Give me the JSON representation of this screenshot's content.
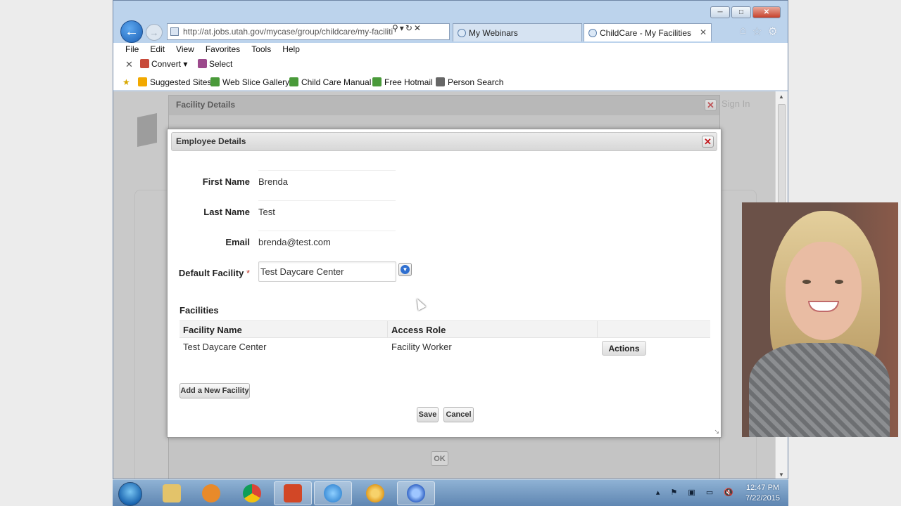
{
  "browser": {
    "address": "http://at.jobs.utah.gov/mycase/group/childcare/my-faciliti",
    "tabs": [
      {
        "label": "My Webinars"
      },
      {
        "label": "ChildCare - My Facilities"
      }
    ],
    "menu": [
      "File",
      "Edit",
      "View",
      "Favorites",
      "Tools",
      "Help"
    ],
    "command": {
      "convert": "Convert",
      "select": "Select"
    },
    "favorites": [
      "Suggested Sites",
      "Web Slice Gallery",
      "Child Care Manual",
      "Free Hotmail",
      "Person Search"
    ]
  },
  "background_page": {
    "facility_dialog_title": "Facility Details",
    "ok_label": "OK",
    "signin_hint": "Sign In"
  },
  "employee_dialog": {
    "title": "Employee Details",
    "fields": {
      "first_name_label": "First Name",
      "first_name": "Brenda",
      "last_name_label": "Last Name",
      "last_name": "Test",
      "email_label": "Email",
      "email": "brenda@test.com",
      "default_facility_label": "Default Facility",
      "default_facility": "Test Daycare Center"
    },
    "facilities_heading": "Facilities",
    "table": {
      "headers": [
        "Facility Name",
        "Access Role",
        ""
      ],
      "rows": [
        {
          "facility": "Test Daycare Center",
          "role": "Facility Worker",
          "action": "Actions"
        }
      ]
    },
    "add_facility_label": "Add a New Facility",
    "save_label": "Save",
    "cancel_label": "Cancel"
  },
  "taskbar": {
    "time": "12:47 PM",
    "date": "7/22/2015"
  },
  "colors": {
    "accent_blue": "#2f6fd0",
    "close_red": "#c2171c",
    "required": "#c0392b"
  }
}
